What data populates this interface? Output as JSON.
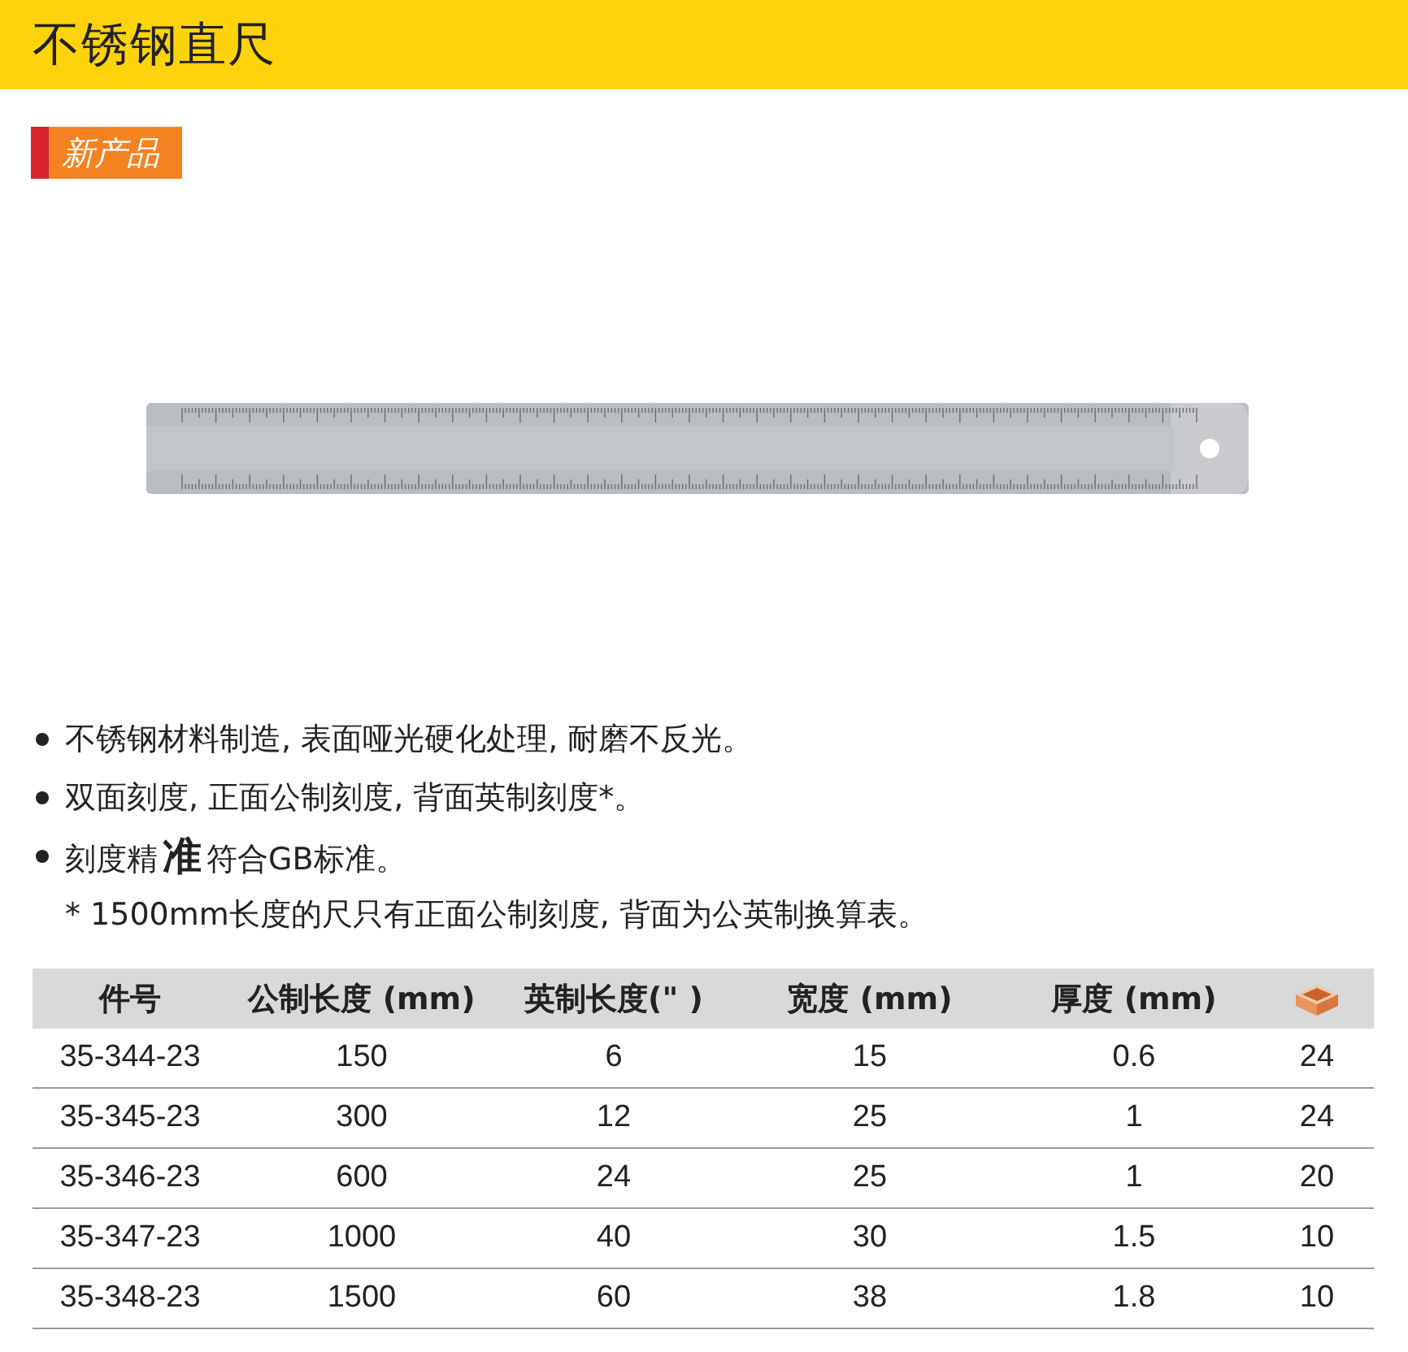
{
  "header": {
    "title": "不锈钢直尺"
  },
  "badge": {
    "label": "新产品"
  },
  "features": [
    {
      "text": "不锈钢材料制造, 表面哑光硬化处理, 耐磨不反光。",
      "bullet": true
    },
    {
      "text": "双面刻度, 正面公制刻度, 背面英制刻度*。",
      "bullet": true
    },
    {
      "text": "刻度精**准**符合GB标准。",
      "bullet": true
    },
    {
      "text": "* 1500mm长度的尺只有正面公制刻度, 背面为公英制换算表。",
      "bullet": false
    }
  ],
  "table": {
    "columns": [
      {
        "kind": "text",
        "label": "件号"
      },
      {
        "kind": "text",
        "label": "公制长度 (mm)"
      },
      {
        "kind": "text",
        "label": "英制长度(\" )"
      },
      {
        "kind": "text",
        "label": "宽度 (mm)"
      },
      {
        "kind": "text",
        "label": "厚度 (mm)"
      },
      {
        "kind": "box-icon"
      }
    ],
    "rows": [
      [
        "35-344-23",
        "150",
        "6",
        "15",
        "0.6",
        "24"
      ],
      [
        "35-345-23",
        "300",
        "12",
        "25",
        "1",
        "24"
      ],
      [
        "35-346-23",
        "600",
        "24",
        "25",
        "1",
        "20"
      ],
      [
        "35-347-23",
        "1000",
        "40",
        "30",
        "1.5",
        "10"
      ],
      [
        "35-348-23",
        "1500",
        "60",
        "38",
        "1.8",
        "10"
      ]
    ]
  }
}
